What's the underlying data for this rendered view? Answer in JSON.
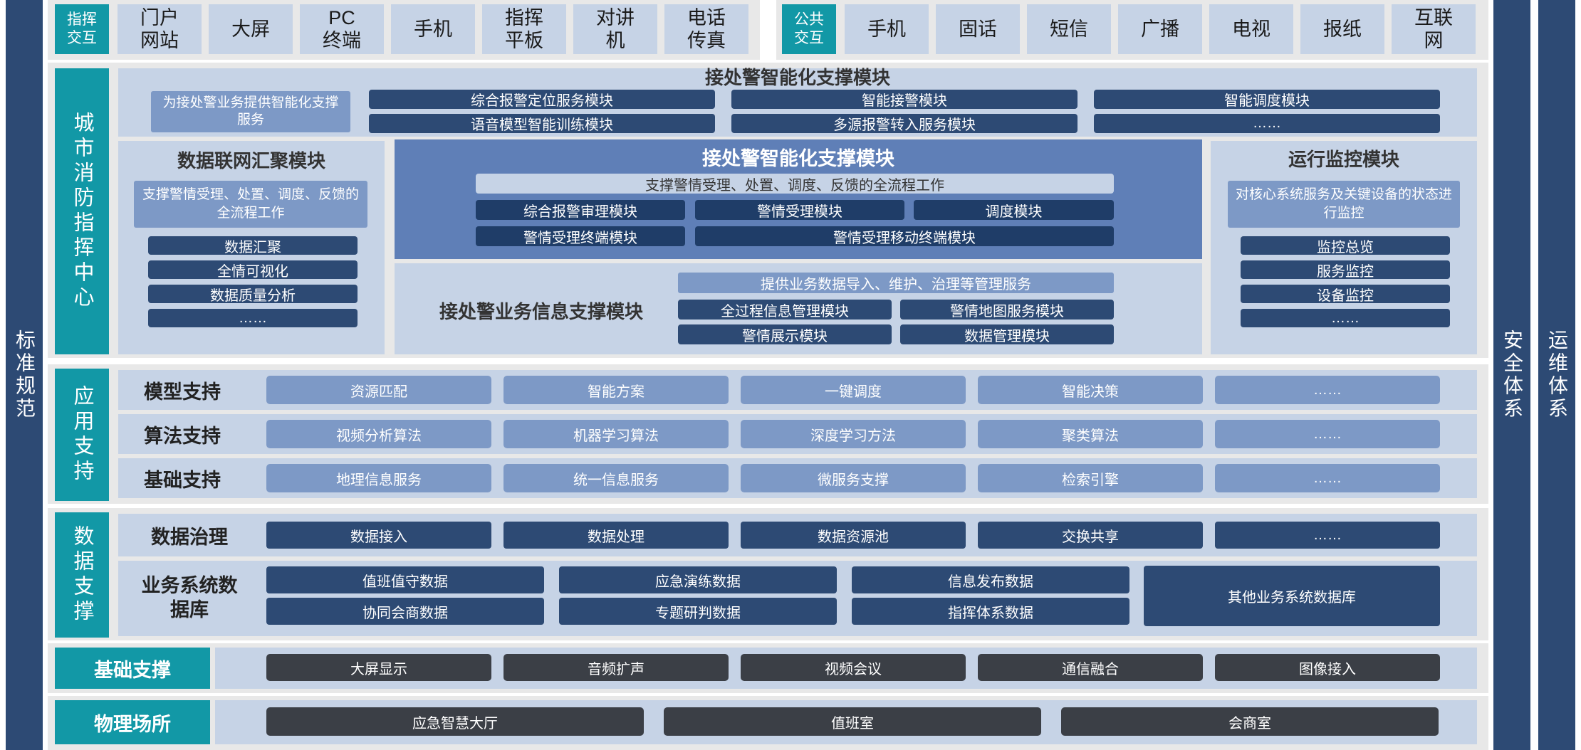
{
  "side": {
    "left": "标准规范",
    "right_inner": "安全体系",
    "right_outer": "运维体系"
  },
  "interaction": {
    "command_label": "指挥交互",
    "command_items": [
      "门户网站",
      "大屏",
      "PC终端",
      "手机",
      "指挥平板",
      "对讲机",
      "电话传真"
    ],
    "public_label": "公共交互",
    "public_items": [
      "手机",
      "固话",
      "短信",
      "广播",
      "电视",
      "报纸",
      "互联网"
    ]
  },
  "center": {
    "label": "城市消防指挥中心",
    "top": {
      "title": "接处警智能化支撑模块",
      "desc": "为接处警业务提供智能化支撑服务",
      "modules": [
        "综合报警定位服务模块",
        "智能接警模块",
        "智能调度模块",
        "语音模型智能训练模块",
        "多源报警转入服务模块",
        "……"
      ]
    },
    "left": {
      "title": "数据联网汇聚模块",
      "desc": "支撑警情受理、处置、调度、反馈的全流程工作",
      "items": [
        "数据汇聚",
        "全情可视化",
        "数据质量分析",
        "……"
      ]
    },
    "main": {
      "title": "接处警智能化支撑模块",
      "desc": "支撑警情受理、处置、调度、反馈的全流程工作",
      "modules": [
        "综合报警审理模块",
        "警情受理模块",
        "调度模块",
        "警情受理终端模块",
        "警情受理移动终端模块"
      ]
    },
    "info": {
      "title": "接处警业务信息支撑模块",
      "desc": "提供业务数据导入、维护、治理等管理服务",
      "modules": [
        "全过程信息管理模块",
        "警情地图服务模块",
        "警情展示模块",
        "数据管理模块"
      ]
    },
    "right": {
      "title": "运行监控模块",
      "desc": "对核心系统服务及关键设备的状态进行监控",
      "items": [
        "监控总览",
        "服务监控",
        "设备监控",
        "……"
      ]
    }
  },
  "app_support": {
    "label": "应用支持",
    "rows": [
      {
        "name": "模型支持",
        "items": [
          "资源匹配",
          "智能方案",
          "一键调度",
          "智能决策",
          "……"
        ]
      },
      {
        "name": "算法支持",
        "items": [
          "视频分析算法",
          "机器学习算法",
          "深度学习方法",
          "聚类算法",
          "……"
        ]
      },
      {
        "name": "基础支持",
        "items": [
          "地理信息服务",
          "统一信息服务",
          "微服务支撑",
          "检索引擎",
          "……"
        ]
      }
    ]
  },
  "data_support": {
    "label": "数据支撑",
    "governance": {
      "name": "数据治理",
      "items": [
        "数据接入",
        "数据处理",
        "数据资源池",
        "交换共享",
        "……"
      ]
    },
    "business": {
      "name": "业务系统数据库",
      "items": [
        "值班值守数据",
        "应急演练数据",
        "信息发布数据",
        "协同会商数据",
        "专题研判数据",
        "指挥体系数据"
      ],
      "other": "其他业务系统数据库"
    }
  },
  "infra": {
    "label": "基础支撑",
    "items": [
      "大屏显示",
      "音频扩声",
      "视频会议",
      "通信融合",
      "图像接入"
    ]
  },
  "places": {
    "label": "物理场所",
    "items": [
      "应急智慧大厅",
      "值班室",
      "会商室"
    ]
  },
  "colors": {
    "navy": "#2d4a74",
    "teal": "#1298a6",
    "panel": "#c6d3e6",
    "mid": "#7d99c6",
    "gray": "#3b3f46"
  }
}
